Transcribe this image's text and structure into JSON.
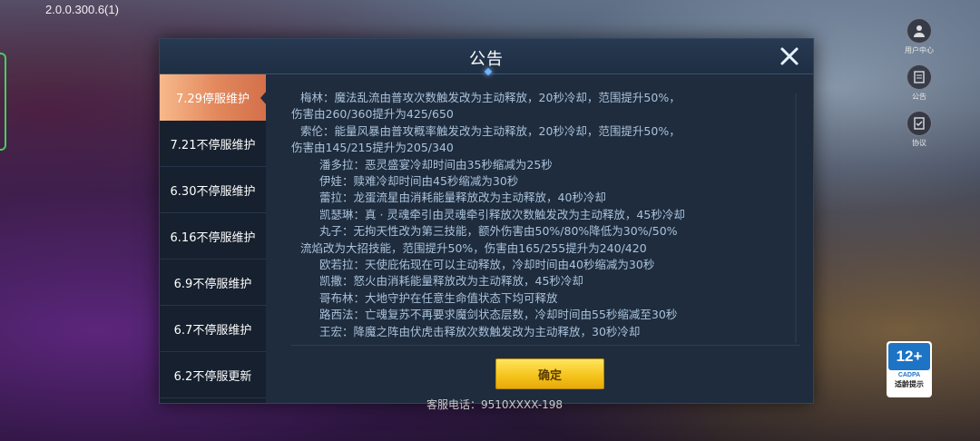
{
  "app": {
    "version": "2.0.0.300.6(1)"
  },
  "side_menu": [
    {
      "label": "用户中心",
      "icon": "user-icon"
    },
    {
      "label": "公告",
      "icon": "announcement-icon"
    },
    {
      "label": "协议",
      "icon": "agreement-icon"
    }
  ],
  "dialog": {
    "title": "公告",
    "tabs": [
      {
        "label": "7.29停服维护",
        "active": true
      },
      {
        "label": "7.21不停服维护",
        "active": false
      },
      {
        "label": "6.30不停服维护",
        "active": false
      },
      {
        "label": "6.16不停服维护",
        "active": false
      },
      {
        "label": "6.9不停服维护",
        "active": false
      },
      {
        "label": "6.7不停服维护",
        "active": false
      },
      {
        "label": "6.2不停服更新",
        "active": false
      }
    ],
    "lines": [
      "梅林：魔法乱流由普攻次数触发改为主动释放，20秒冷却，范围提升50%，",
      "伤害由260/360提升为425/650",
      "索伦：能量风暴由普攻概率触发改为主动释放，20秒冷却，范围提升50%，",
      "伤害由145/215提升为205/340",
      "潘多拉：恶灵盛宴冷却时间由35秒缩减为25秒",
      "伊娃：赎难冷却时间由45秒缩减为30秒",
      "蕾拉：龙蛋流星由消耗能量释放改为主动释放，40秒冷却",
      "凯瑟琳：真 · 灵魂牵引由灵魂牵引释放次数触发改为主动释放，45秒冷却",
      "丸子：无拘天性改为第三技能，额外伤害由50%/80%降低为30%/50%",
      "流焰改为大招技能，范围提升50%，伤害由165/255提升为240/420",
      "欧若拉：天使庇佑现在可以主动释放，冷却时间由40秒缩减为30秒",
      "凯撒：怒火由消耗能量释放改为主动释放，45秒冷却",
      "哥布林：大地守护在任意生命值状态下均可释放",
      "路西法：亡魂复苏不再要求魔剑状态层数，冷却时间由55秒缩减至30秒",
      "王宏：降魔之阵由伏虎击释放次数触发改为主动释放，30秒冷却"
    ],
    "confirm_label": "确定"
  },
  "rating": {
    "age": "12+",
    "org": "CADPA",
    "note": "适龄提示"
  },
  "hotline": "客服电话：9510XXXX-198",
  "colors": {
    "tab_active": "#e2875c",
    "confirm": "#f4c21a",
    "panel": "#1f2c3e"
  }
}
